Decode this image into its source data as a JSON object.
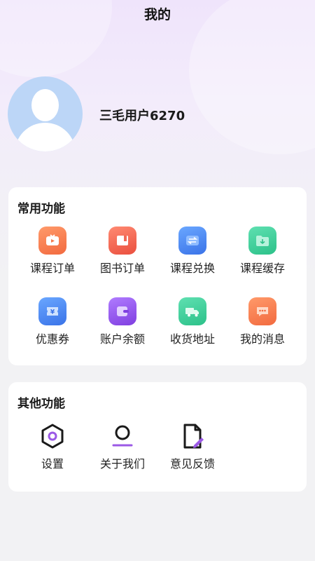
{
  "header": {
    "title": "我的"
  },
  "profile": {
    "username": "三毛用户6270"
  },
  "common": {
    "title": "常用功能",
    "items": [
      {
        "label": "课程订单",
        "icon": "course-order-icon",
        "color": "#f5794a"
      },
      {
        "label": "图书订单",
        "icon": "book-order-icon",
        "color": "#f26a57"
      },
      {
        "label": "课程兑换",
        "icon": "course-exchange-icon",
        "color": "#4c8df2"
      },
      {
        "label": "课程缓存",
        "icon": "course-cache-icon",
        "color": "#3fcf9c"
      },
      {
        "label": "优惠券",
        "icon": "coupon-icon",
        "color": "#4c8df2"
      },
      {
        "label": "账户余额",
        "icon": "wallet-icon",
        "color": "#9656ea"
      },
      {
        "label": "收货地址",
        "icon": "truck-icon",
        "color": "#3fcf9c"
      },
      {
        "label": "我的消息",
        "icon": "message-icon",
        "color": "#f5794a"
      }
    ]
  },
  "other": {
    "title": "其他功能",
    "items": [
      {
        "label": "设置",
        "icon": "settings-icon"
      },
      {
        "label": "关于我们",
        "icon": "about-us-icon"
      },
      {
        "label": "意见反馈",
        "icon": "feedback-icon"
      }
    ]
  },
  "colors": {
    "accent": "#9b59e6",
    "background": "#f2f2f4",
    "avatar": "#bcd6f7"
  }
}
